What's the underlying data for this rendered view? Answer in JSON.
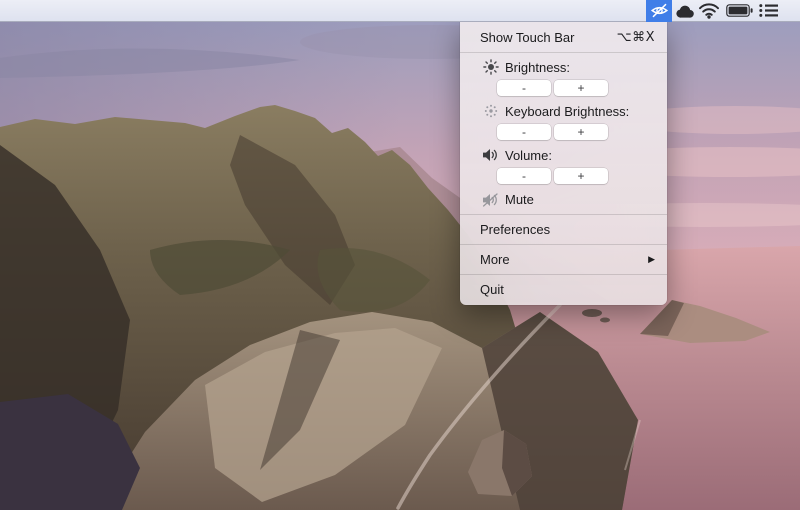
{
  "colors": {
    "accent_blue": "#407ee8",
    "menubar_bg": "#e2e5f1",
    "menu_bg": "#ece5e7",
    "button_bg": "#ffffff"
  },
  "menubar": {
    "status_icons": [
      {
        "name": "eye-hidden-icon",
        "selected": true
      },
      {
        "name": "cloud-icon",
        "selected": false
      },
      {
        "name": "wifi-icon",
        "selected": false
      },
      {
        "name": "battery-icon",
        "selected": false
      },
      {
        "name": "list-icon",
        "selected": false
      }
    ]
  },
  "menu": {
    "show_touch_bar": {
      "label": "Show Touch Bar",
      "shortcut": "⌥⌘X"
    },
    "brightness": {
      "icon": "sun-icon",
      "label": "Brightness:",
      "minus": "-",
      "plus": "+"
    },
    "keyboard_brightness": {
      "icon": "keyboard-brightness-icon",
      "label": "Keyboard Brightness:",
      "minus": "-",
      "plus": "+"
    },
    "volume": {
      "icon": "speaker-icon",
      "label": "Volume:",
      "minus": "-",
      "plus": "+"
    },
    "mute": {
      "icon": "speaker-mute-icon",
      "label": "Mute"
    },
    "preferences": {
      "label": "Preferences"
    },
    "more": {
      "label": "More",
      "submenu_arrow": "▶"
    },
    "quit": {
      "label": "Quit"
    }
  }
}
